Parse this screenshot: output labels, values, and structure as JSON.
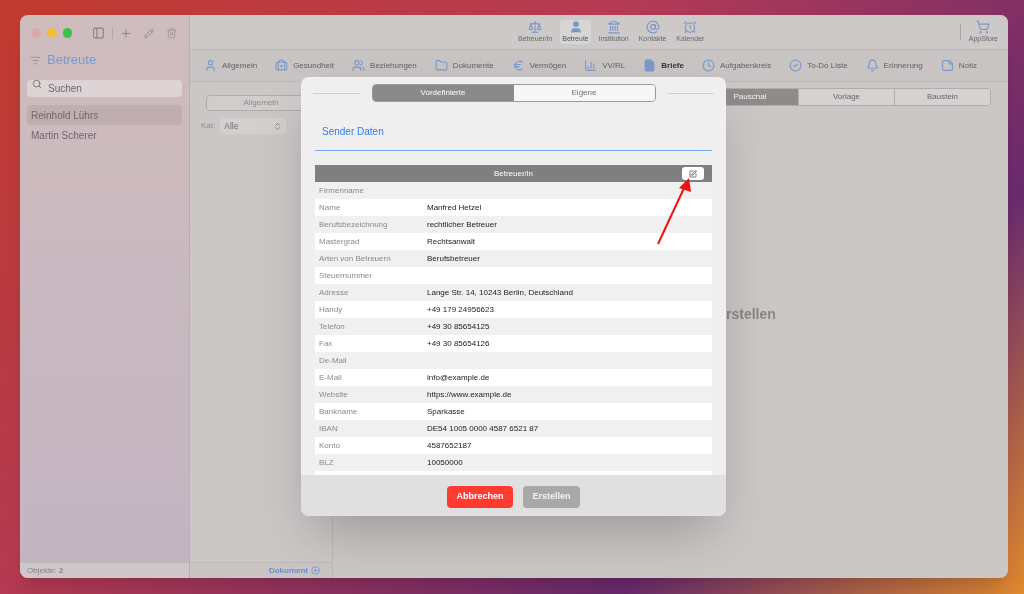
{
  "sidebar": {
    "title": "Betreute",
    "search": {
      "placeholder": "Suchen"
    },
    "items": [
      {
        "label": "Reinhold Lührs",
        "selected": true
      },
      {
        "label": "Martin Scherer",
        "selected": false
      }
    ],
    "status": "Objekte: **2**"
  },
  "top_tabs": [
    {
      "label": "Betreuer/in",
      "selected": false
    },
    {
      "label": "Betreute",
      "selected": true
    },
    {
      "label": "Institution",
      "selected": false
    },
    {
      "label": "Kontakte",
      "selected": false
    },
    {
      "label": "Kalender",
      "selected": false
    }
  ],
  "appstore": "AppStore",
  "categories": [
    {
      "label": "Allgemein",
      "selected": false
    },
    {
      "label": "Gesundheit",
      "selected": false
    },
    {
      "label": "Beziehungen",
      "selected": false
    },
    {
      "label": "Dokumente",
      "selected": false
    },
    {
      "label": "Vermögen",
      "selected": false
    },
    {
      "label": "VV/RL",
      "selected": false
    },
    {
      "label": "Briefe",
      "selected": true
    },
    {
      "label": "Aufgabenkreis",
      "selected": false
    },
    {
      "label": "To-Do Liste",
      "selected": false
    },
    {
      "label": "Erinnerung",
      "selected": false
    },
    {
      "label": "Notiz",
      "selected": false
    }
  ],
  "list_panel": {
    "segment": "Allgemein",
    "filter_label": "Kat:",
    "filter_value": "Alle",
    "footer": "Dokument"
  },
  "content": {
    "segments": [
      {
        "label": "Pauschal",
        "selected": true
      },
      {
        "label": "Vorlage",
        "selected": false
      },
      {
        "label": "Baustein",
        "selected": false
      }
    ],
    "placeholder_text": "rstellen"
  },
  "dialog": {
    "segments": [
      {
        "label": "Vordefinierte",
        "selected": true
      },
      {
        "label": "Eigene",
        "selected": false
      }
    ],
    "tab": "Sender Daten",
    "table_title": "Betreuer/in",
    "rows": [
      {
        "label": "Firmenname",
        "value": ""
      },
      {
        "label": "Name",
        "value": "Manfred Hetzel"
      },
      {
        "label": "Berufsbezeichnung",
        "value": "rechtlicher Betreuer"
      },
      {
        "label": "Mastergrad",
        "value": "Rechtsanwalt"
      },
      {
        "label": "Arten von Betreuern",
        "value": "Berufsbetreuer"
      },
      {
        "label": "Steuernummer",
        "value": ""
      },
      {
        "label": "Adresse",
        "value": "Lange Str. 14, 10243 Berlin, Deutschland"
      },
      {
        "label": "Handy",
        "value": "+49 179 24956623"
      },
      {
        "label": "Telefon",
        "value": "+49 30 85654125"
      },
      {
        "label": "Fax",
        "value": "+49 30 85654126"
      },
      {
        "label": "De-Mail",
        "value": ""
      },
      {
        "label": "E-Mail",
        "value": "info@example.de"
      },
      {
        "label": "Website",
        "value": "https://www.example.de"
      },
      {
        "label": "Bankname",
        "value": "Sparkasse"
      },
      {
        "label": "IBAN",
        "value": "DE54 1005 0000 4587 6521 87"
      },
      {
        "label": "Konto",
        "value": "4587652187"
      },
      {
        "label": "BLZ",
        "value": "10050000"
      }
    ],
    "cancel": "Abbrechen",
    "create": {
      "label": "Erstellen",
      "disabled": true
    }
  }
}
